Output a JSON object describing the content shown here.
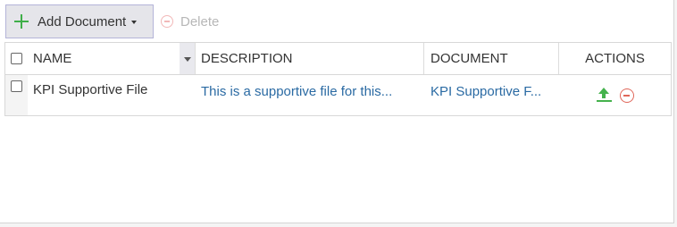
{
  "toolbar": {
    "add_label": "Add Document",
    "add_icon": "plus-icon",
    "delete_label": "Delete",
    "delete_icon": "minus-circle-icon"
  },
  "grid": {
    "columns": {
      "name": "NAME",
      "description": "DESCRIPTION",
      "document": "DOCUMENT",
      "actions": "ACTIONS"
    },
    "rows": [
      {
        "name": "KPI Supportive File",
        "description": "This is a supportive file for this...",
        "document": "KPI Supportive F...",
        "actions": [
          "upload-icon",
          "remove-icon"
        ]
      }
    ]
  },
  "colors": {
    "add_icon": "#3fae49",
    "delete_disabled": "#f2b8b8",
    "link": "#2a6aa3",
    "upload": "#45b24d",
    "remove": "#e0675a"
  }
}
